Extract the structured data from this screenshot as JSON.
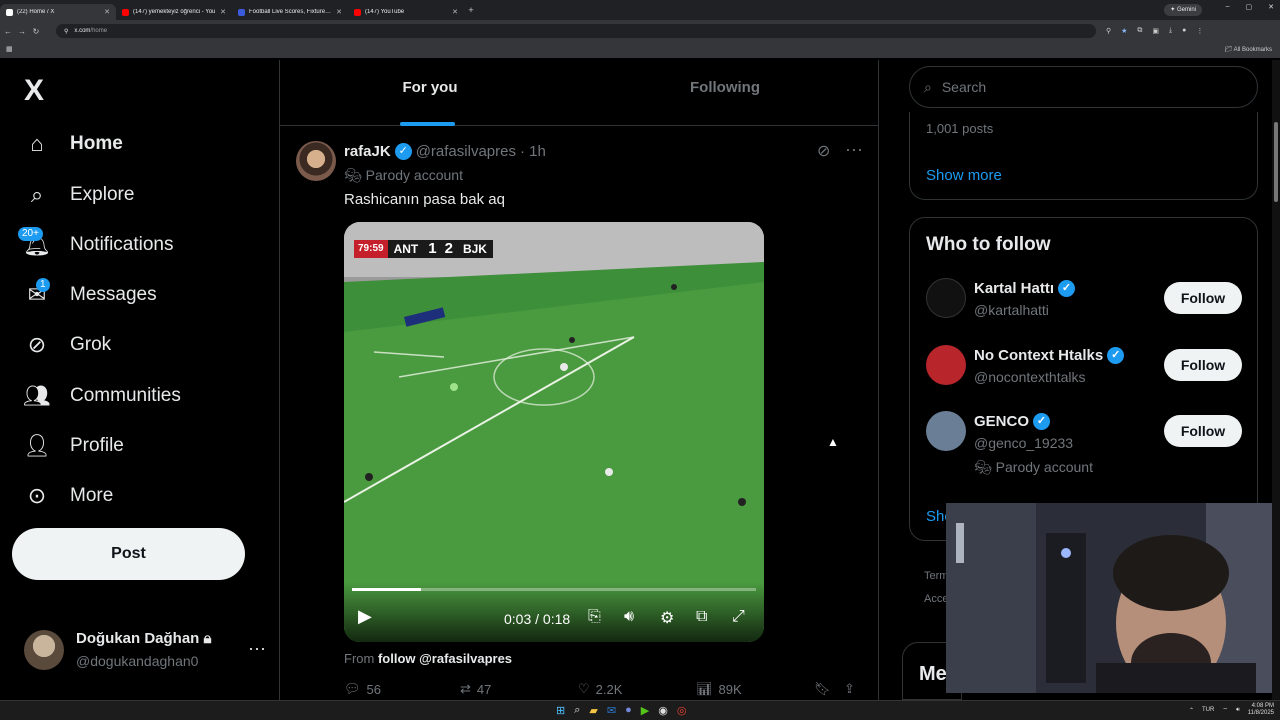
{
  "browser": {
    "tabs": [
      {
        "title": "(22) Home / X",
        "fav_color": "#ffffff",
        "active": true
      },
      {
        "title": "(147) yemekteyiz öğrenci - You",
        "fav_color": "#ff0000",
        "active": false
      },
      {
        "title": "Football Live Scores, Fixtures &",
        "fav_color": "#3b5bdb",
        "active": false
      },
      {
        "title": "(147) YouTube",
        "fav_color": "#ff0000",
        "active": false
      }
    ],
    "gemini_label": "Gemini",
    "url_domain": "x.com",
    "url_path": "/home",
    "all_bookmarks": "All Bookmarks"
  },
  "nav": {
    "logo": "X",
    "items": [
      {
        "label": "Home",
        "icon": "home-icon",
        "glyph": "⌂"
      },
      {
        "label": "Explore",
        "icon": "search-icon",
        "glyph": "⌕"
      },
      {
        "label": "Notifications",
        "icon": "bell-icon",
        "glyph": "🔔︎",
        "badge": "20+"
      },
      {
        "label": "Messages",
        "icon": "mail-icon",
        "glyph": "✉",
        "badge": "1"
      },
      {
        "label": "Grok",
        "icon": "grok-icon",
        "glyph": "⊘"
      },
      {
        "label": "Communities",
        "icon": "communities-icon",
        "glyph": "👥︎"
      },
      {
        "label": "Profile",
        "icon": "profile-icon",
        "glyph": "👤︎"
      },
      {
        "label": "More",
        "icon": "more-circle-icon",
        "glyph": "⊙"
      }
    ],
    "post_button": "Post",
    "account": {
      "name": "Doğukan Dağhan",
      "handle": "@dogukandaghan0",
      "lock": "🔒︎",
      "more": "···"
    }
  },
  "timeline": {
    "tabs": {
      "for_you": "For you",
      "following": "Following"
    },
    "post": {
      "name": "rafaJK",
      "handle": "@rafasilvapres",
      "time": "· 1h",
      "parody": "Parody account",
      "text": "Rashicanın pasa bak aq",
      "video": {
        "scorebug": {
          "time": "79:59",
          "home": "ANT",
          "home_score": "1",
          "away_score": "2",
          "away": "BJK"
        },
        "time_display": "0:03 / 0:18",
        "progress": 0.17
      },
      "from_label": "From",
      "from_link": "follow @rafasilvapres",
      "stats": {
        "replies": "56",
        "reposts": "47",
        "likes": "2.2K",
        "views": "89K"
      }
    }
  },
  "sidebar": {
    "search_placeholder": "Search",
    "trend": {
      "posts": "1,001 posts",
      "show_more": "Show more"
    },
    "who_to_follow": {
      "title": "Who to follow",
      "items": [
        {
          "name": "Kartal Hattı",
          "handle": "@kartalhatti",
          "button": "Follow",
          "avatar_color": "#111111"
        },
        {
          "name": "No Context Htalks",
          "handle": "@nocontexthtalks",
          "button": "Follow",
          "avatar_color": "#b8262c"
        },
        {
          "name": "GENCO",
          "handle": "@genco_19233",
          "parody": "Parody account",
          "button": "Follow",
          "avatar_color": "#6a7f96"
        }
      ],
      "show_more": "Show more"
    },
    "terms": [
      "Term",
      "Acce"
    ],
    "messages_drawer": "Me"
  },
  "taskbar": {
    "lang": "TUR",
    "time": "4:08 PM",
    "date": "11/8/2025"
  },
  "colors": {
    "accent": "#1d9bf0",
    "background": "#000000",
    "border": "#2f3336",
    "muted": "#71767b"
  }
}
